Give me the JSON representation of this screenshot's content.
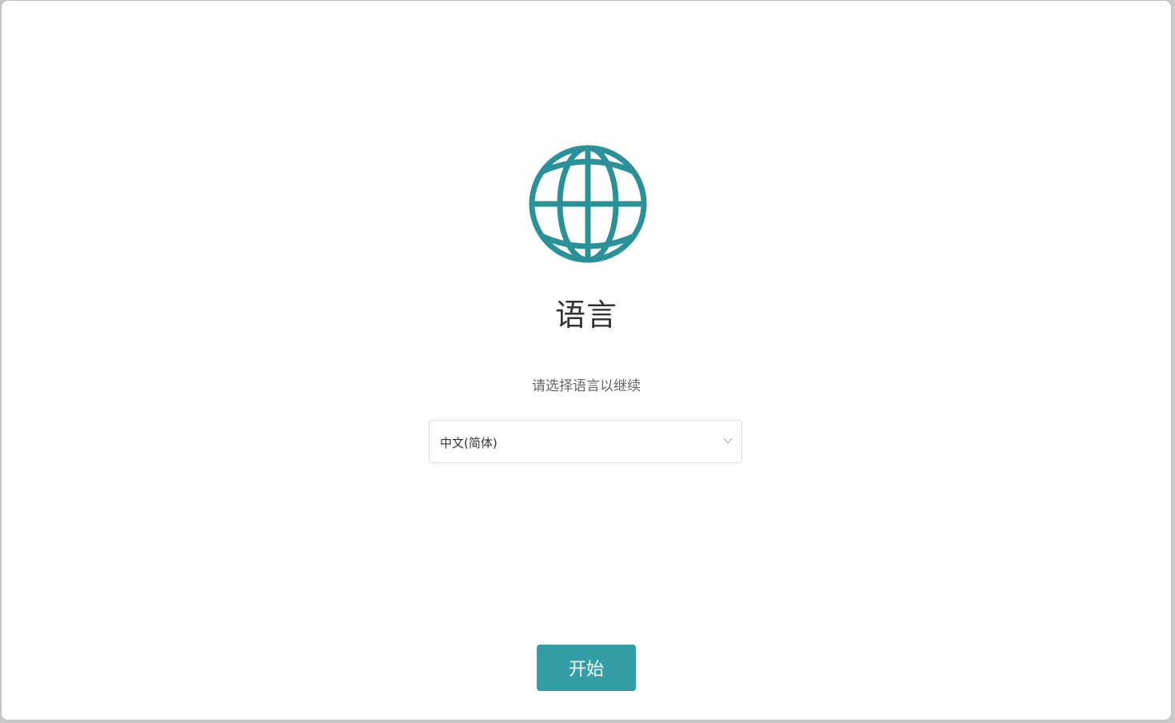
{
  "page": {
    "title": "语言",
    "subtitle": "请选择语言以继续"
  },
  "language_select": {
    "selected_value": "中文(简体)"
  },
  "start_button": {
    "label": "开始"
  },
  "icons": {
    "main": "globe-icon",
    "dropdown": "chevron-down-icon"
  },
  "colors": {
    "accent": "#339ea5",
    "globe": "#2a9198",
    "title_text": "#333333",
    "subtitle_text": "#666666"
  }
}
